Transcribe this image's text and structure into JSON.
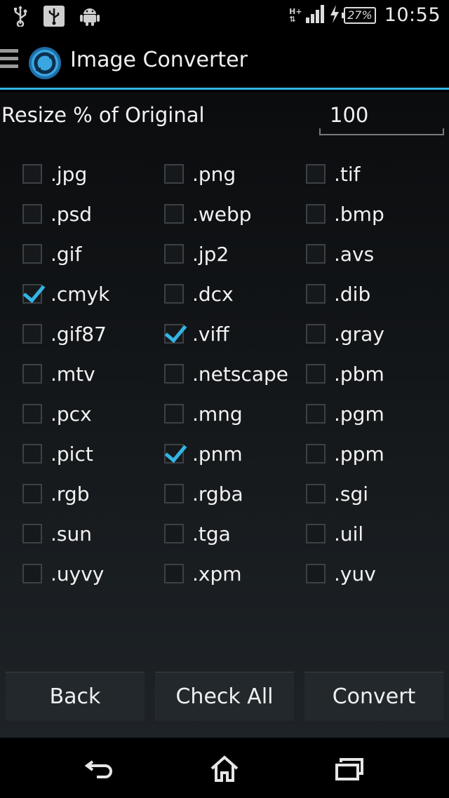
{
  "status_bar": {
    "left_icons": [
      "usb-icon",
      "usb-debug-icon",
      "android-icon"
    ],
    "network_label": "H+",
    "battery": "27%",
    "time": "10:55"
  },
  "action_bar": {
    "title": "Image Converter",
    "accent_color": "#33b5e5"
  },
  "resize": {
    "label": "Resize % of Original",
    "value": "100"
  },
  "formats": [
    {
      "label": ".jpg",
      "checked": false
    },
    {
      "label": ".png",
      "checked": false
    },
    {
      "label": ".tif",
      "checked": false
    },
    {
      "label": ".psd",
      "checked": false
    },
    {
      "label": ".webp",
      "checked": false
    },
    {
      "label": ".bmp",
      "checked": false
    },
    {
      "label": ".gif",
      "checked": false
    },
    {
      "label": ".jp2",
      "checked": false
    },
    {
      "label": ".avs",
      "checked": false
    },
    {
      "label": ".cmyk",
      "checked": true
    },
    {
      "label": ".dcx",
      "checked": false
    },
    {
      "label": ".dib",
      "checked": false
    },
    {
      "label": ".gif87",
      "checked": false
    },
    {
      "label": ".viff",
      "checked": true
    },
    {
      "label": ".gray",
      "checked": false
    },
    {
      "label": ".mtv",
      "checked": false
    },
    {
      "label": ".netscape",
      "checked": false
    },
    {
      "label": ".pbm",
      "checked": false
    },
    {
      "label": ".pcx",
      "checked": false
    },
    {
      "label": ".mng",
      "checked": false
    },
    {
      "label": ".pgm",
      "checked": false
    },
    {
      "label": ".pict",
      "checked": false
    },
    {
      "label": ".pnm",
      "checked": true
    },
    {
      "label": ".ppm",
      "checked": false
    },
    {
      "label": ".rgb",
      "checked": false
    },
    {
      "label": ".rgba",
      "checked": false
    },
    {
      "label": ".sgi",
      "checked": false
    },
    {
      "label": ".sun",
      "checked": false
    },
    {
      "label": ".tga",
      "checked": false
    },
    {
      "label": ".uil",
      "checked": false
    },
    {
      "label": ".uyvy",
      "checked": false
    },
    {
      "label": ".xpm",
      "checked": false
    },
    {
      "label": ".yuv",
      "checked": false
    }
  ],
  "buttons": {
    "back": "Back",
    "check_all": "Check All",
    "convert": "Convert"
  },
  "nav_bar": [
    "back-nav-icon",
    "home-icon",
    "recents-icon"
  ]
}
